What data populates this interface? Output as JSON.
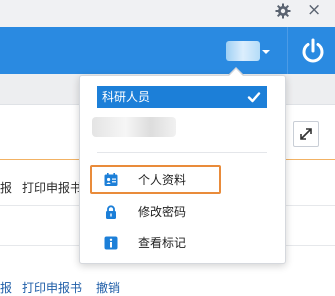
{
  "topbar": {
    "settings_icon": "gear-icon",
    "close_glyph": "×"
  },
  "header": {
    "power_icon": "power-icon",
    "accent": "#2a8ae1"
  },
  "table_rows": [
    {
      "text_a": "报",
      "text_b": "打印申报书"
    },
    {
      "text_a": "报",
      "text_b": "打印申报书",
      "text_c": "撤销"
    }
  ],
  "user_menu": {
    "role": {
      "label": "科研人员",
      "selected": true
    },
    "items": [
      {
        "label": "个人资料",
        "icon": "profile-card-icon",
        "highlighted": true
      },
      {
        "label": "修改密码",
        "icon": "lock-icon"
      },
      {
        "label": "查看标记",
        "icon": "info-icon"
      }
    ],
    "highlight_color": "#e98b3a"
  }
}
